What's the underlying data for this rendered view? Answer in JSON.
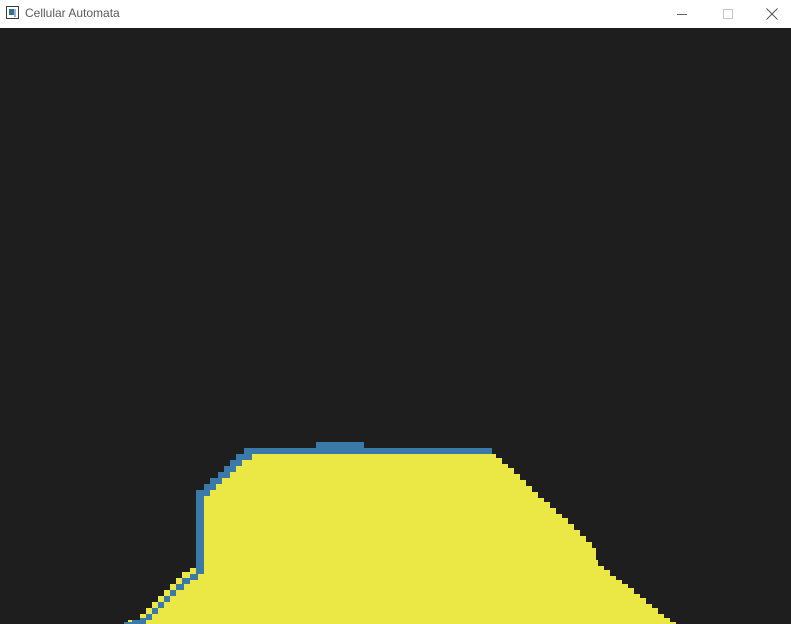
{
  "window": {
    "title": "Cellular Automata",
    "icon": "app-window-icon",
    "controls": {
      "minimize_icon": "minimize-icon",
      "maximize_icon": "maximize-icon",
      "close_icon": "close-icon"
    }
  },
  "canvas": {
    "colors": {
      "background": "#1e1e1e",
      "sand": "#ebe845",
      "water": "#3a79a8"
    }
  }
}
